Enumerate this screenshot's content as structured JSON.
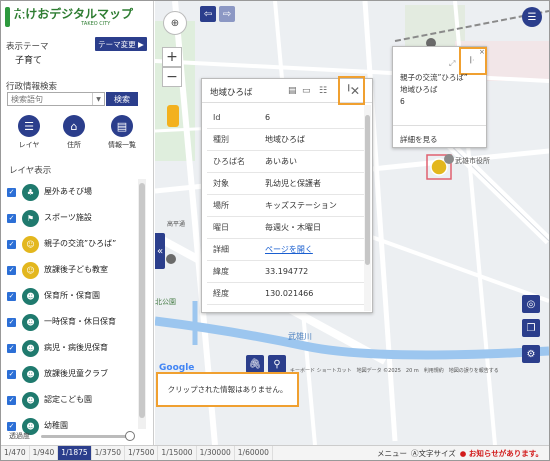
{
  "app": {
    "logo_text": "たけおデジタルマップ",
    "logo_sub": "TAKEO CITY"
  },
  "sidebar": {
    "theme_label": "表示テーマ",
    "theme_button": "テーマ変更 ▶",
    "theme_value": "子育て",
    "search_label": "行政情報検索",
    "search_placeholder": "検索語句",
    "search_button": "検索",
    "nav": [
      {
        "label": "レイヤ",
        "icon": "list-icon"
      },
      {
        "label": "住所",
        "icon": "home-icon"
      },
      {
        "label": "情報一覧",
        "icon": "table-icon"
      }
    ],
    "layers_heading": "レイヤ表示",
    "layers": [
      {
        "name": "屋外あそび場",
        "color": "#1f7a6e"
      },
      {
        "name": "スポーツ施設",
        "color": "#1f7a6e"
      },
      {
        "name": "親子の交流”ひろば”",
        "color": "#e3b71e"
      },
      {
        "name": "放課後子ども教室",
        "color": "#e3b71e"
      },
      {
        "name": "保育所・保育園",
        "color": "#1f7a6e"
      },
      {
        "name": "一時保育・休日保育",
        "color": "#1f7a6e"
      },
      {
        "name": "病児・病後児保育",
        "color": "#1f7a6e"
      },
      {
        "name": "放課後児童クラブ",
        "color": "#1f7a6e"
      },
      {
        "name": "認定こども園",
        "color": "#1f7a6e"
      },
      {
        "name": "幼稚園",
        "color": "#1f7a6e"
      }
    ],
    "opacity_label": "透過度"
  },
  "map": {
    "labels": {
      "city_hall": "武雄市役所",
      "river": "武雄川",
      "park": "北公園",
      "street": "高平通"
    },
    "google": "Google",
    "attribution": "キーボード ショートカット　地図データ ©2025　20 m　利用規約　地図の誤りを報告する"
  },
  "popup": {
    "title": "地域ひろば",
    "rows": [
      {
        "key": "Id",
        "value": "6"
      },
      {
        "key": "種別",
        "value": "地域ひろば"
      },
      {
        "key": "ひろば名",
        "value": "あいあい"
      },
      {
        "key": "対象",
        "value": "乳幼児と保護者"
      },
      {
        "key": "場所",
        "value": "キッズステーション"
      },
      {
        "key": "曜日",
        "value": "毎週火・木曜日"
      },
      {
        "key": "詳細",
        "value": "ページを開く"
      },
      {
        "key": "緯度",
        "value": "33.194772"
      },
      {
        "key": "経度",
        "value": "130.021466"
      }
    ]
  },
  "popup2": {
    "line1": "親子の交流”ひろば”",
    "line2": "地域ひろば",
    "line3": "6",
    "link": "詳細を見る"
  },
  "clip_message": "クリップされた情報はありません。",
  "scales": [
    "1/470",
    "1/940",
    "1/1875",
    "1/3750",
    "1/7500",
    "1/15000",
    "1/30000",
    "1/60000"
  ],
  "scale_active": "1/1875",
  "footer": {
    "menu": "メニュー",
    "font_size": "Ⓐ文字サイズ",
    "notice": "お知らせがあります。"
  }
}
